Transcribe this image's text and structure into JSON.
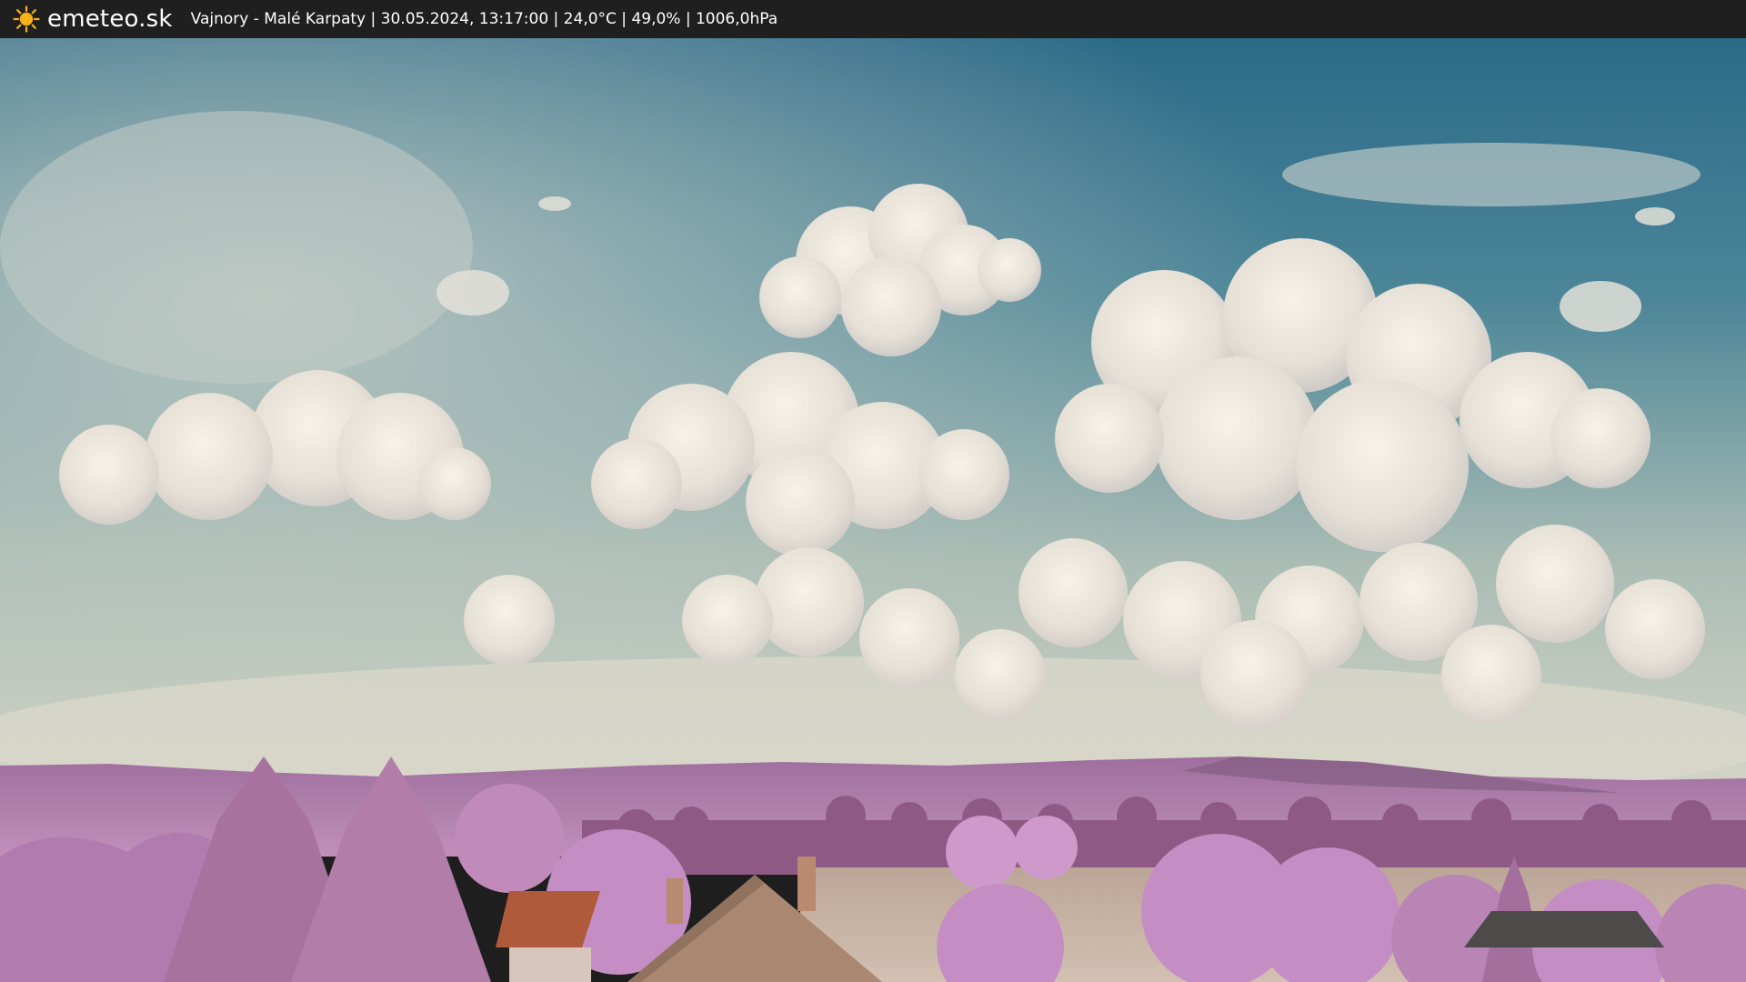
{
  "header": {
    "logo_icon": "sun-icon",
    "brand": "emeteo.sk",
    "caption": "Vajnory - Malé Karpaty | 30.05.2024, 13:17:00 | 24,0°C | 49,0% | 1006,0hPa"
  },
  "colors": {
    "topbar": "#1f1f1f",
    "sun": "#f5b21b",
    "sky_top": "#2f6f8d",
    "sky_haze": "#c9ccc0",
    "cloud": "#efebe2",
    "hills": "#b583b0",
    "foliage": "#c48ec4",
    "roof": "#b05a3c",
    "field": "#c9b6a8"
  }
}
